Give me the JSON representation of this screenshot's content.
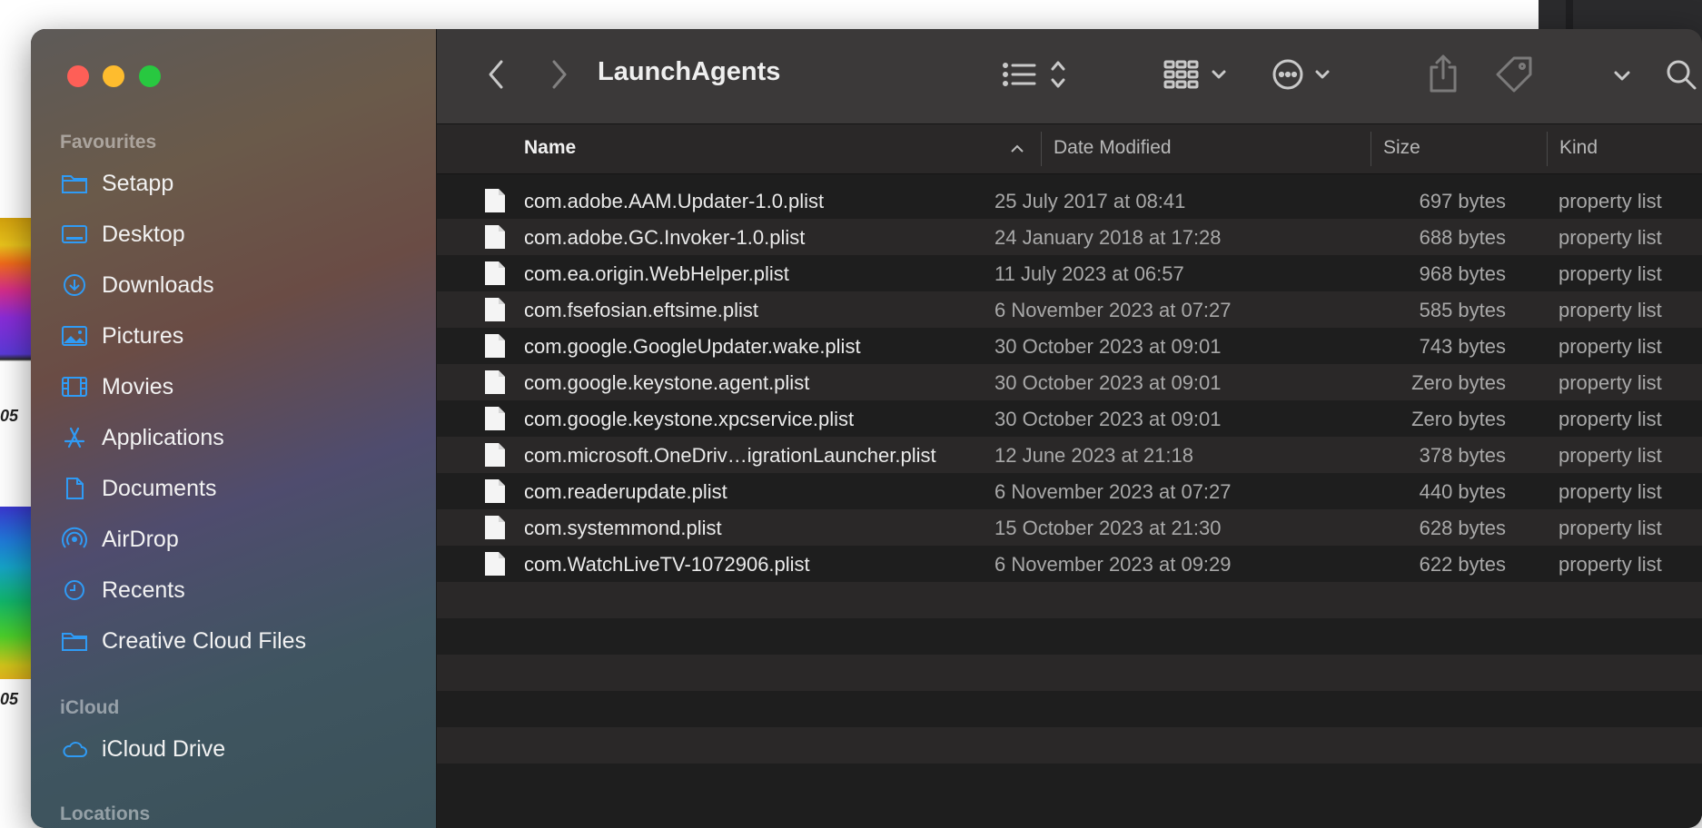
{
  "window": {
    "title": "LaunchAgents"
  },
  "background": {
    "label_top": "05",
    "label_bottom": "05"
  },
  "sidebar": {
    "sections": [
      {
        "title": "Favourites",
        "items": [
          {
            "label": "Setapp",
            "icon": "folder-icon"
          },
          {
            "label": "Desktop",
            "icon": "desktop-icon"
          },
          {
            "label": "Downloads",
            "icon": "download-icon"
          },
          {
            "label": "Pictures",
            "icon": "photo-icon"
          },
          {
            "label": "Movies",
            "icon": "film-icon"
          },
          {
            "label": "Applications",
            "icon": "applications-icon"
          },
          {
            "label": "Documents",
            "icon": "document-icon"
          },
          {
            "label": "AirDrop",
            "icon": "airdrop-icon"
          },
          {
            "label": "Recents",
            "icon": "clock-icon"
          },
          {
            "label": "Creative Cloud Files",
            "icon": "folder-icon"
          }
        ]
      },
      {
        "title": "iCloud",
        "items": [
          {
            "label": "iCloud Drive",
            "icon": "cloud-icon"
          }
        ]
      },
      {
        "title": "Locations",
        "items": []
      }
    ]
  },
  "columns": {
    "name": "Name",
    "date": "Date Modified",
    "size": "Size",
    "kind": "Kind"
  },
  "files": [
    {
      "name": "com.adobe.AAM.Updater-1.0.plist",
      "date": "25 July 2017 at 08:41",
      "size": "697 bytes",
      "kind": "property list"
    },
    {
      "name": "com.adobe.GC.Invoker-1.0.plist",
      "date": "24 January 2018 at 17:28",
      "size": "688 bytes",
      "kind": "property list"
    },
    {
      "name": "com.ea.origin.WebHelper.plist",
      "date": "11 July 2023 at 06:57",
      "size": "968 bytes",
      "kind": "property list"
    },
    {
      "name": "com.fsefosian.eftsime.plist",
      "date": "6 November 2023 at 07:27",
      "size": "585 bytes",
      "kind": "property list"
    },
    {
      "name": "com.google.GoogleUpdater.wake.plist",
      "date": "30 October 2023 at 09:01",
      "size": "743 bytes",
      "kind": "property list"
    },
    {
      "name": "com.google.keystone.agent.plist",
      "date": "30 October 2023 at 09:01",
      "size": "Zero bytes",
      "kind": "property list"
    },
    {
      "name": "com.google.keystone.xpcservice.plist",
      "date": "30 October 2023 at 09:01",
      "size": "Zero bytes",
      "kind": "property list"
    },
    {
      "name": "com.microsoft.OneDriv…igrationLauncher.plist",
      "date": "12 June 2023 at 21:18",
      "size": "378 bytes",
      "kind": "property list"
    },
    {
      "name": "com.readerupdate.plist",
      "date": "6 November 2023 at 07:27",
      "size": "440 bytes",
      "kind": "property list"
    },
    {
      "name": "com.systemmond.plist",
      "date": "15 October 2023 at 21:30",
      "size": "628 bytes",
      "kind": "property list"
    },
    {
      "name": "com.WatchLiveTV-1072906.plist",
      "date": "6 November 2023 at 09:29",
      "size": "622 bytes",
      "kind": "property list"
    }
  ],
  "colors": {
    "accent": "#2f9bf5",
    "close": "#fe5f57",
    "minimize": "#febc2e",
    "zoom": "#28c840"
  }
}
